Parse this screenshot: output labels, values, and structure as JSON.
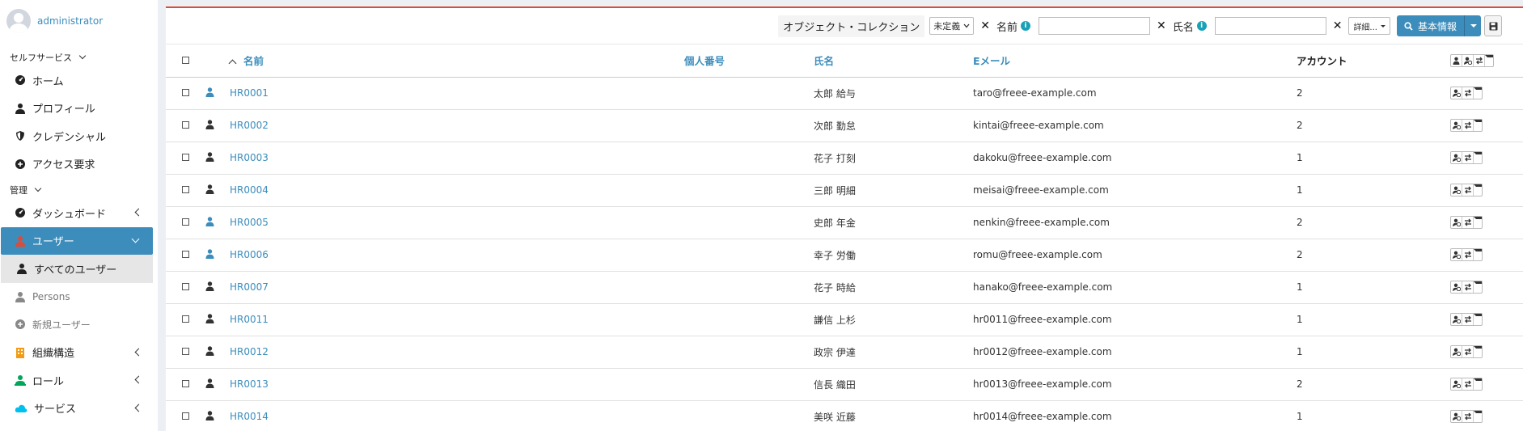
{
  "user": {
    "name": "administrator"
  },
  "sidebar": {
    "selfservice_header": "セルフサービス",
    "selfservice_items": [
      {
        "label": "ホーム",
        "icon": "dashboard-icon"
      },
      {
        "label": "プロフィール",
        "icon": "user-icon"
      },
      {
        "label": "クレデンシャル",
        "icon": "shield-icon"
      },
      {
        "label": "アクセス要求",
        "icon": "plus-circle-icon"
      }
    ],
    "admin_header": "管理",
    "dashboard": "ダッシュボード",
    "users": "ユーザー",
    "all_users": "すべてのユーザー",
    "persons": "Persons",
    "new_user": "新規ユーザー",
    "org": "組織構造",
    "role": "ロール",
    "service": "サービス"
  },
  "toolbar": {
    "object_collection": "オブジェクト・コレクション",
    "undefined_option": "未定義",
    "name_label": "名前",
    "fullname_label": "氏名",
    "details": "詳細...",
    "basic_info": "基本情報"
  },
  "table": {
    "headers": {
      "name": "名前",
      "personal_number": "個人番号",
      "full_name": "氏名",
      "email": "Eメール",
      "account": "アカウント"
    },
    "rows": [
      {
        "id": "HR0001",
        "full_name": "太郎 給与",
        "email": "taro@freee-example.com",
        "accounts": "2",
        "icon_color": "#3c8dbc"
      },
      {
        "id": "HR0002",
        "full_name": "次郎 勤怠",
        "email": "kintai@freee-example.com",
        "accounts": "2",
        "icon_color": "#333333"
      },
      {
        "id": "HR0003",
        "full_name": "花子 打刻",
        "email": "dakoku@freee-example.com",
        "accounts": "1",
        "icon_color": "#333333"
      },
      {
        "id": "HR0004",
        "full_name": "三郎 明細",
        "email": "meisai@freee-example.com",
        "accounts": "1",
        "icon_color": "#333333"
      },
      {
        "id": "HR0005",
        "full_name": "史郎 年金",
        "email": "nenkin@freee-example.com",
        "accounts": "2",
        "icon_color": "#3c8dbc"
      },
      {
        "id": "HR0006",
        "full_name": "幸子 労働",
        "email": "romu@freee-example.com",
        "accounts": "2",
        "icon_color": "#3c8dbc"
      },
      {
        "id": "HR0007",
        "full_name": "花子 時給",
        "email": "hanako@freee-example.com",
        "accounts": "1",
        "icon_color": "#333333"
      },
      {
        "id": "HR0011",
        "full_name": "謙信 上杉",
        "email": "hr0011@freee-example.com",
        "accounts": "1",
        "icon_color": "#333333"
      },
      {
        "id": "HR0012",
        "full_name": "政宗 伊達",
        "email": "hr0012@freee-example.com",
        "accounts": "1",
        "icon_color": "#333333"
      },
      {
        "id": "HR0013",
        "full_name": "信長 織田",
        "email": "hr0013@freee-example.com",
        "accounts": "2",
        "icon_color": "#333333"
      },
      {
        "id": "HR0014",
        "full_name": "美咲 近藤",
        "email": "hr0014@freee-example.com",
        "accounts": "1",
        "icon_color": "#333333"
      }
    ]
  },
  "colors": {
    "primary": "#3c8dbc",
    "accent_top": "#dd4b39",
    "users_icon": "#dd4b39",
    "org_icon": "#f39c12",
    "role_icon": "#00a65a",
    "service_icon": "#00c0ef"
  }
}
